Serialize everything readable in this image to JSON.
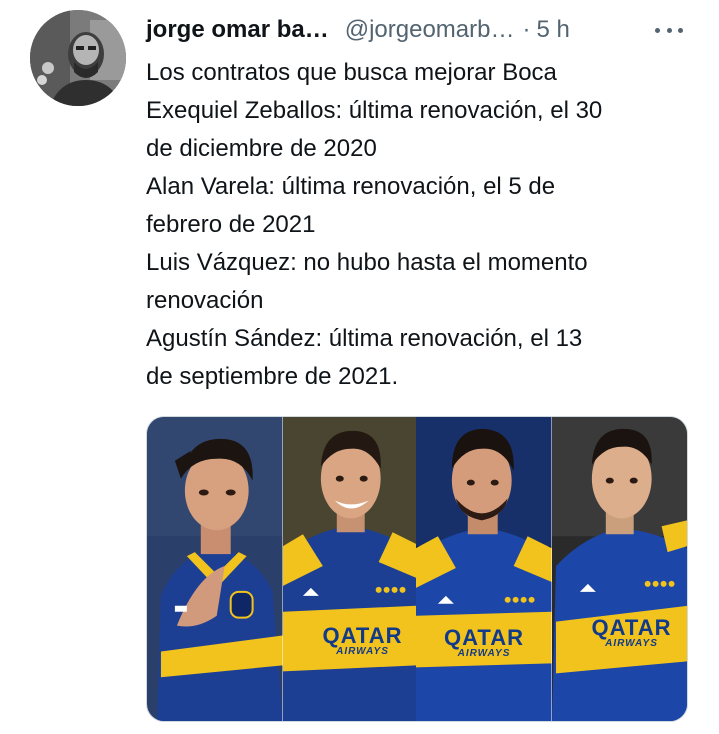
{
  "tweet": {
    "author_name": "jorge omar ba…",
    "author_handle": "@jorgeomarb…",
    "separator": "·",
    "timestamp": "5 h",
    "text_lines": [
      "Los contratos que busca mejorar Boca",
      "Exequiel Zeballos: última renovación, el 30",
      "de diciembre de 2020",
      "Alan Varela: última renovación, el 5 de",
      "febrero de 2021",
      "Luis Vázquez: no hubo hasta el momento",
      "renovación",
      "Agustín Sández: última renovación, el 13",
      "de septiembre de 2021."
    ],
    "media": {
      "panels": [
        {
          "sponsor": "",
          "sponsor_sub": ""
        },
        {
          "sponsor": "QATAR",
          "sponsor_sub": "AIRWAYS"
        },
        {
          "sponsor": "QATAR",
          "sponsor_sub": "AIRWAYS"
        },
        {
          "sponsor": "QATAR",
          "sponsor_sub": "AIRWAYS"
        }
      ]
    }
  },
  "icons": {
    "more": "more-dots-icon"
  },
  "colors": {
    "text_primary": "#0f1419",
    "text_secondary": "#536471",
    "border": "#cfd9de",
    "boca_blue": "#1c3f94",
    "boca_gold": "#f2c31c"
  }
}
